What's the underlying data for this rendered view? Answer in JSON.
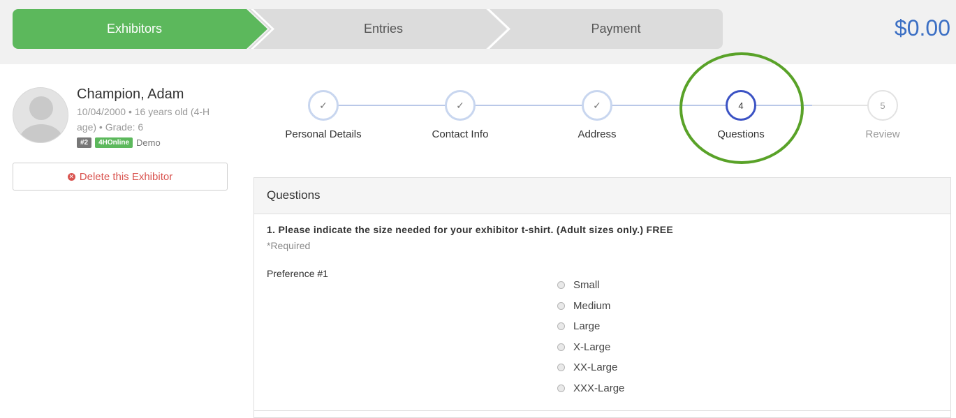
{
  "wizard": {
    "steps": [
      "Exhibitors",
      "Entries",
      "Payment"
    ],
    "total": "$0.00",
    "colors": {
      "active": "#5cb85c",
      "inactive": "#dcdcdc",
      "total": "#3b6fc4"
    }
  },
  "exhibitor": {
    "name": "Champion, Adam",
    "meta": "10/04/2000 • 16 years old (4-H age) • Grade: 6",
    "number_tag": "#2",
    "source_tag": "4HOnline",
    "type": "Demo",
    "delete_label": "Delete this Exhibitor"
  },
  "progress": {
    "steps": [
      {
        "label": "Personal Details",
        "marker": "✓",
        "state": "done"
      },
      {
        "label": "Contact Info",
        "marker": "✓",
        "state": "done"
      },
      {
        "label": "Address",
        "marker": "✓",
        "state": "done"
      },
      {
        "label": "Questions",
        "marker": "4",
        "state": "current"
      },
      {
        "label": "Review",
        "marker": "5",
        "state": "todo"
      }
    ]
  },
  "questions": {
    "heading": "Questions",
    "q1": {
      "text": "1. Please indicate the size needed for your exhibitor t-shirt. (Adult sizes only.) FREE",
      "required": "*Required",
      "preference_label": "Preference #1",
      "options": [
        "Small",
        "Medium",
        "Large",
        "X-Large",
        "XX-Large",
        "XXX-Large"
      ]
    }
  }
}
